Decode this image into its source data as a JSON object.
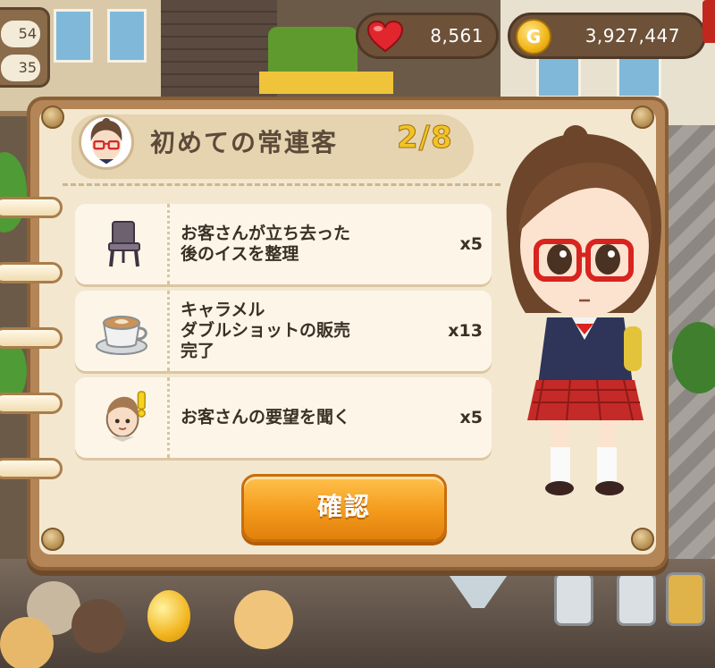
{
  "hud": {
    "left_values": [
      "54",
      "35"
    ],
    "hearts": "8,561",
    "gold_icon_letter": "G",
    "gold": "3,927,447",
    "heart_icon": "heart-icon",
    "coin_icon": "gold-coin-icon"
  },
  "quest": {
    "title": "初めての常連客",
    "progress": "2/8",
    "tasks": [
      {
        "icon": "chair-icon",
        "label": "お客さんが立ち去った\n後のイスを整理",
        "count": "x5"
      },
      {
        "icon": "coffee-cup-icon",
        "label": "キャラメル\nダブルショットの販売\n完了",
        "count": "x13"
      },
      {
        "icon": "customer-request-icon",
        "label": "お客さんの要望を聞く",
        "count": "x5"
      }
    ],
    "confirm_label": "確認"
  },
  "colors": {
    "board": "#b48556",
    "panel": "#f3e7cf",
    "progress": "#f4c324",
    "button": "#f39a1b"
  }
}
